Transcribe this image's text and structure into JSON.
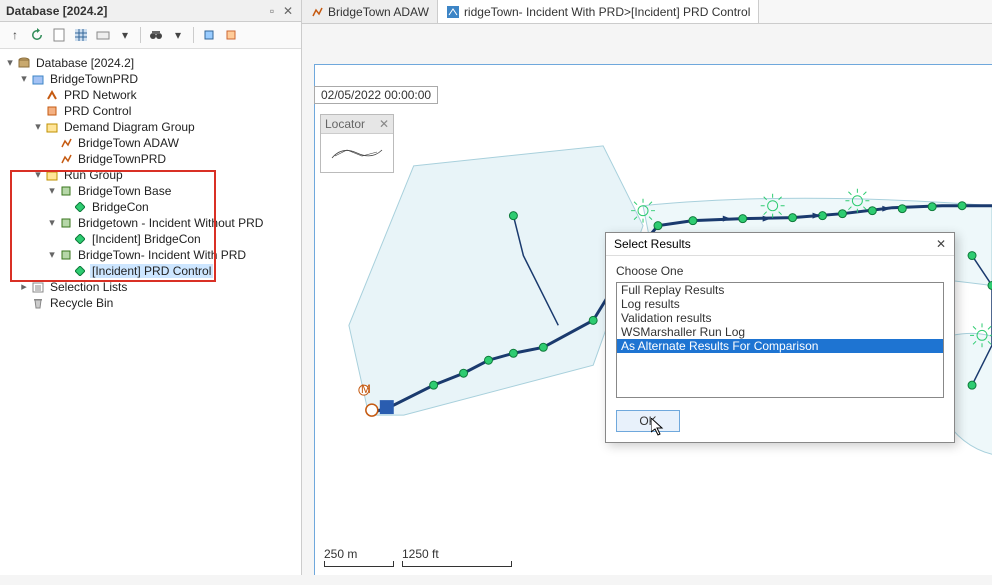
{
  "panel": {
    "title": "Database [2024.2]"
  },
  "tree": {
    "root": "Database [2024.2]",
    "prd": "BridgeTownPRD",
    "network": "PRD Network",
    "control": "PRD Control",
    "ddg": "Demand Diagram Group",
    "adaw": "BridgeTown ADAW",
    "ddg_prd": "BridgeTownPRD",
    "rungroup": "Run Group",
    "run1": "BridgeTown Base",
    "run1c": "BridgeCon",
    "run2": "Bridgetown - Incident Without PRD",
    "run2c": "[Incident] BridgeCon",
    "run3": "BridgeTown- Incident With PRD",
    "run3c": "[Incident] PRD Control",
    "sel": "Selection Lists",
    "bin": "Recycle Bin"
  },
  "tabs": {
    "tab1": "BridgeTown ADAW",
    "tab2": "ridgeTown- Incident With PRD>[Incident] PRD Control"
  },
  "canvas": {
    "title": "BridgeTown- Incident With PRD>[Incident] PRD Control",
    "timestamp": "02/05/2022 00:00:00",
    "locator": "Locator",
    "scale1": "250 m",
    "scale2": "1250 ft"
  },
  "dialog": {
    "title": "Select Results",
    "label": "Choose One",
    "options": [
      "Full Replay Results",
      "Log results",
      "Validation results",
      "WSMarshaller Run Log",
      "As Alternate Results For Comparison"
    ],
    "selected_index": 4,
    "ok": "OK"
  }
}
